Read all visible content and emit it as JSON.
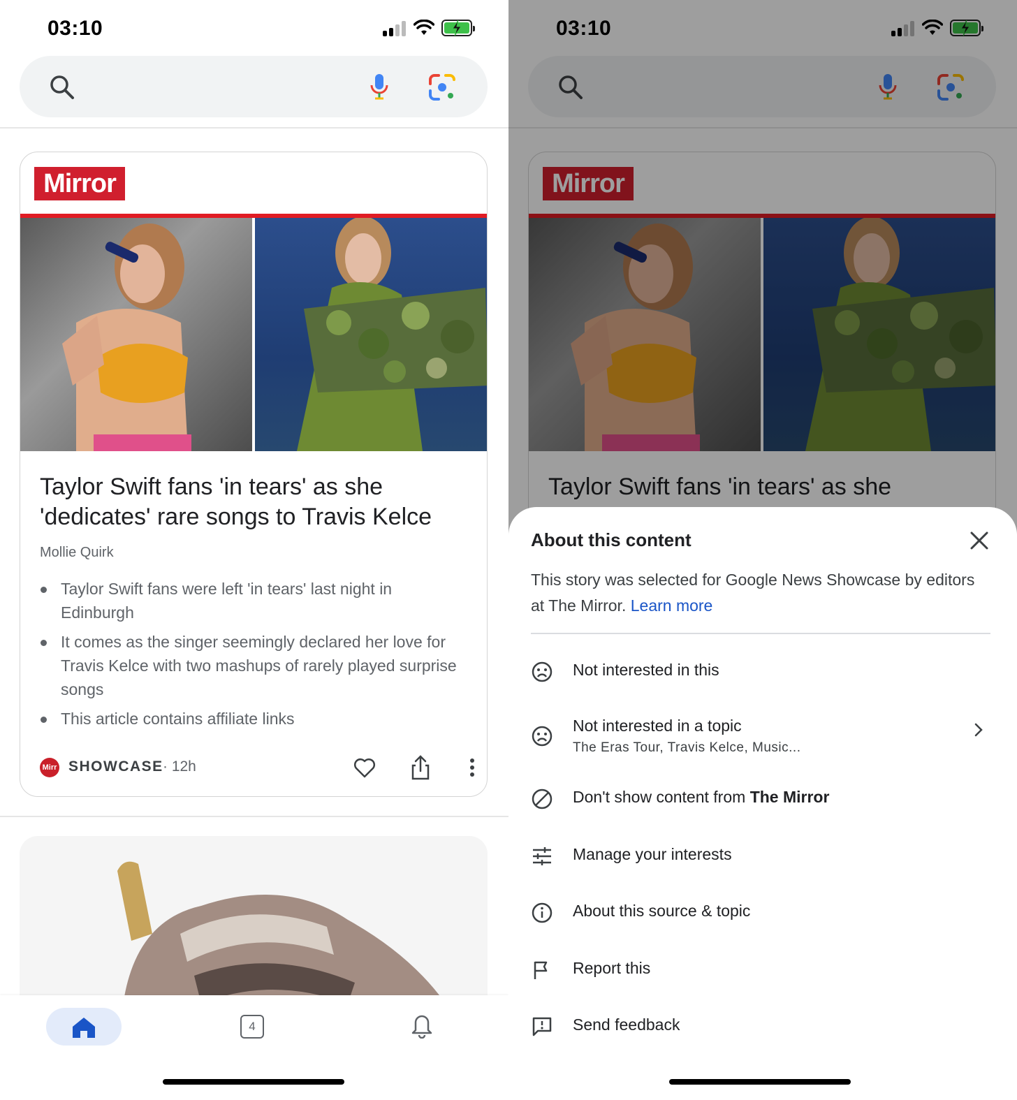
{
  "status": {
    "time": "03:10"
  },
  "card": {
    "logo_text": "Mirror",
    "headline": "Taylor Swift fans 'in tears' as she 'dedicates' rare songs to Travis Kelce",
    "author": "Mollie Quirk",
    "bullets": [
      "Taylor Swift fans were left 'in tears' last night in Edinburgh",
      "It comes as the singer seemingly declared her love for Travis Kelce with two mashups of rarely played surprise songs",
      "This article contains affiliate links"
    ],
    "source_label": "SHOWCASE",
    "source_icon_text": "Mirr",
    "time_ago": "· 12h"
  },
  "bottom_nav": {
    "tabs_count": "4"
  },
  "sheet": {
    "title": "About this content",
    "description": "This story was selected for Google News Showcase by editors at The Mirror.",
    "learn_more": "Learn more",
    "items": [
      {
        "label": "Not interested in this",
        "icon": "sad-face-icon"
      },
      {
        "label": "Not interested in a topic",
        "sublabel": "The Eras Tour, Travis Kelce, Music...",
        "icon": "sad-face-icon"
      },
      {
        "label": "Don't show content from ",
        "label_bold": "The Mirror",
        "icon": "block-icon"
      },
      {
        "label": "Manage your interests",
        "icon": "tune-icon"
      },
      {
        "label": "About this source & topic",
        "icon": "info-icon"
      },
      {
        "label": "Report this",
        "icon": "flag-icon"
      },
      {
        "label": "Send feedback",
        "icon": "feedback-icon"
      }
    ]
  },
  "colors": {
    "accent_blue": "#1a55c7",
    "mirror_red": "#d01f2e",
    "battery_green": "#3ec04a"
  }
}
